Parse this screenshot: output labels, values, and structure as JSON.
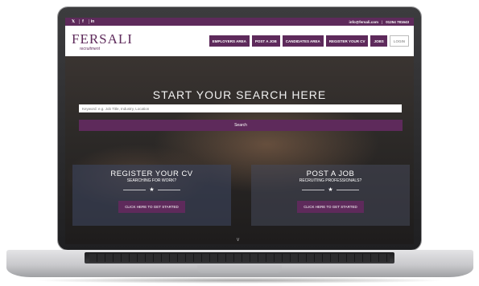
{
  "topbar": {
    "social": [
      "𝕏",
      "f",
      "in"
    ],
    "email": "info@fersali.com",
    "phone": "01254 781643"
  },
  "brand": {
    "name": "FERSALI",
    "tagline": "recruitment"
  },
  "nav": {
    "items": [
      "EMPLOYERS AREA",
      "POST A JOB",
      "CANDIDATES AREA",
      "REGISTER YOUR CV",
      "JOBS"
    ],
    "login": "LOGIN"
  },
  "hero": {
    "title": "START YOUR SEARCH HERE",
    "search_placeholder": "Keyword: e.g. Job Title, Industry, Location",
    "search_button": "Search"
  },
  "panels": [
    {
      "title": "REGISTER YOUR CV",
      "subtitle": "SEARCHING FOR WORK?",
      "cta": "CLICK HERE TO GET STARTED"
    },
    {
      "title": "POST A JOB",
      "subtitle": "RECRUITING PROFESSIONALS?",
      "cta": "CLICK HERE TO GET STARTED"
    }
  ],
  "colors": {
    "brand_purple": "#5e2a5b",
    "laptop_bezel": "#2a2a2c",
    "laptop_silver": "#c9c9cc"
  },
  "icons": {
    "scroll": "chevron-down-icon",
    "divider": "star-icon"
  }
}
